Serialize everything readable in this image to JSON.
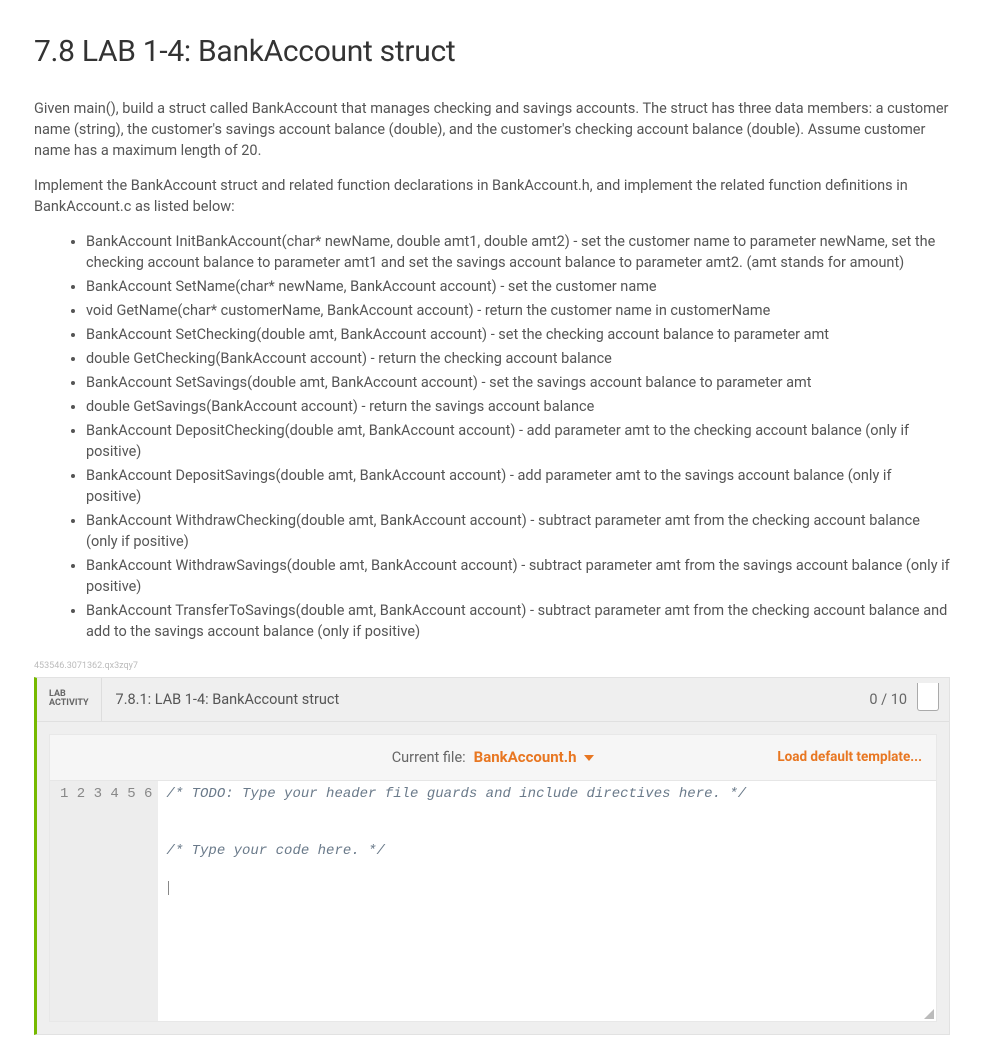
{
  "title": "7.8 LAB 1-4: BankAccount struct",
  "para1": "Given main(), build a struct called BankAccount that manages checking and savings accounts. The struct has three data members: a customer name (string), the customer's savings account balance (double), and the customer's checking account balance (double). Assume customer name has a maximum length of 20.",
  "para2": "Implement the BankAccount struct and related function declarations in BankAccount.h, and implement the related function definitions in BankAccount.c as listed below:",
  "funcs": [
    "BankAccount InitBankAccount(char* newName, double amt1, double amt2) - set the customer name to parameter newName, set the checking account balance to parameter amt1 and set the savings account balance to parameter amt2. (amt stands for amount)",
    "BankAccount SetName(char* newName, BankAccount account) - set the customer name",
    "void GetName(char* customerName, BankAccount account) - return the customer name in customerName",
    "BankAccount SetChecking(double amt, BankAccount account) - set the checking account balance to parameter amt",
    "double GetChecking(BankAccount account) - return the checking account balance",
    "BankAccount SetSavings(double amt, BankAccount account) - set the savings account balance to parameter amt",
    "double GetSavings(BankAccount account) - return the savings account balance",
    "BankAccount DepositChecking(double amt, BankAccount account) - add parameter amt to the checking account balance (only if positive)",
    "BankAccount DepositSavings(double amt, BankAccount account) - add parameter amt to the savings account balance (only if positive)",
    "BankAccount WithdrawChecking(double amt, BankAccount account) - subtract parameter amt from the checking account balance (only if positive)",
    "BankAccount WithdrawSavings(double amt, BankAccount account) - subtract parameter amt from the savings account balance (only if positive)",
    "BankAccount TransferToSavings(double amt, BankAccount account) - subtract parameter amt from the checking account balance and add to the savings account balance (only if positive)"
  ],
  "hash": "453546.3071362.qx3zqy7",
  "lab": {
    "activity_label_line1": "LAB",
    "activity_label_line2": "ACTIVITY",
    "title": "7.8.1: LAB 1-4: BankAccount struct",
    "score": "0 / 10"
  },
  "editor": {
    "current_file_label": "Current file:",
    "current_file_name": "BankAccount.h",
    "load_default": "Load default template...",
    "lines": [
      "/* TODO: Type your header file guards and include directives here. */",
      "",
      "",
      "/* Type your code here. */",
      "",
      ""
    ]
  }
}
